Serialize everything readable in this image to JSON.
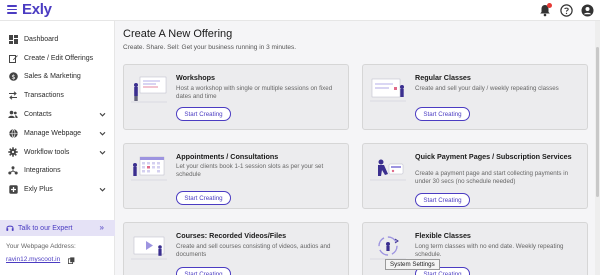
{
  "app": {
    "logo": "Exly"
  },
  "topbar": {
    "icons": [
      "notification-bell-icon",
      "help-icon",
      "account-icon"
    ],
    "colors": {
      "brand": "#4b3cc2",
      "notification": "#e53935"
    }
  },
  "sidebar": {
    "items": [
      {
        "label": "Dashboard",
        "icon": "dashboard-icon",
        "expandable": false
      },
      {
        "label": "Create / Edit Offerings",
        "icon": "edit-icon",
        "expandable": false
      },
      {
        "label": "Sales & Marketing",
        "icon": "dollar-icon",
        "expandable": false
      },
      {
        "label": "Transactions",
        "icon": "transfer-icon",
        "expandable": false
      },
      {
        "label": "Contacts",
        "icon": "contacts-icon",
        "expandable": true
      },
      {
        "label": "Manage Webpage",
        "icon": "globe-icon",
        "expandable": true
      },
      {
        "label": "Workflow tools",
        "icon": "gear-icon",
        "expandable": true
      },
      {
        "label": "Integrations",
        "icon": "integrations-icon",
        "expandable": false
      },
      {
        "label": "Exly Plus",
        "icon": "plus-icon",
        "expandable": true
      }
    ],
    "expert": {
      "label": "Talk to our Expert",
      "arrow": "»"
    },
    "webpage": {
      "label": "Your Webpage Address:",
      "url": "ravin12.myscoot.in"
    }
  },
  "main": {
    "title": "Create A New Offering",
    "subtitle": "Create. Share. Sell: Get your business running in 3 minutes.",
    "cards": [
      {
        "title": "Workshops",
        "description": "Host a workshop with single or multiple sessions on fixed dates and time",
        "button": "Start Creating",
        "illustration": "workshop-illustration"
      },
      {
        "title": "Regular Classes",
        "description": "Create and sell your daily / weekly repeating classes",
        "button": "Start Creating",
        "illustration": "regular-classes-illustration"
      },
      {
        "title": "Appointments / Consultations",
        "description": "Let your clients book 1-1 session slots as per your set schedule",
        "button": "Start Creating",
        "illustration": "appointments-illustration"
      },
      {
        "title": "Quick Payment Pages / Subscription Services",
        "description": "Create a payment page and start collecting payments in under 30 secs (no schedule needed)",
        "button": "Start Creating",
        "illustration": "payment-illustration"
      },
      {
        "title": "Courses: Recorded Videos/Files",
        "description": "Create and sell courses consisting of videos, audios and documents",
        "button": "Start Creating",
        "illustration": "courses-illustration"
      },
      {
        "title": "Flexible Classes",
        "description": "Long term classes with no end date. Weekly repeating schedule.",
        "button": "Start Creating",
        "illustration": "flexible-classes-illustration"
      }
    ]
  },
  "tooltip": {
    "text": "System Settings"
  }
}
